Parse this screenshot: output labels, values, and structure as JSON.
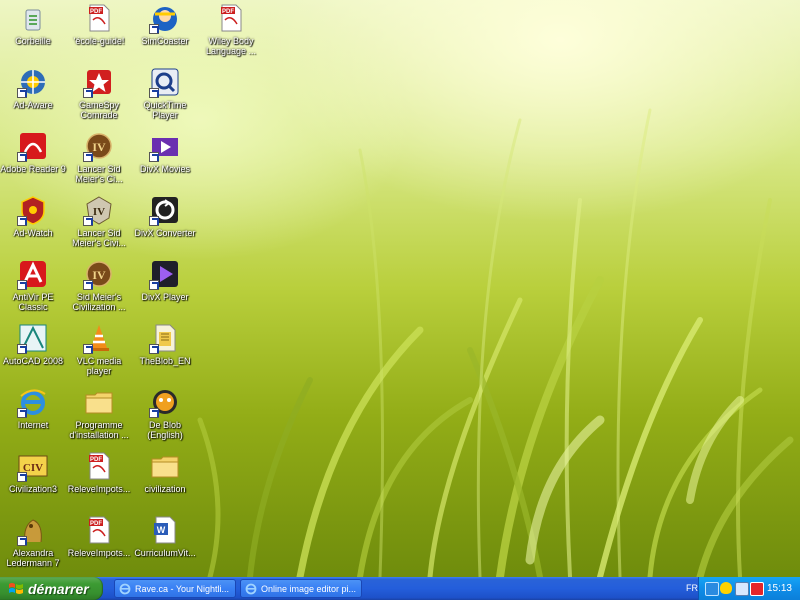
{
  "desktop": {
    "icons": [
      {
        "label": "Corbeille",
        "icon": "recycle-bin-icon",
        "shortcut": false
      },
      {
        "label": "Ad-Aware",
        "icon": "ad-aware-icon",
        "shortcut": true
      },
      {
        "label": "Adobe Reader 9",
        "icon": "adobe-reader-icon",
        "shortcut": true
      },
      {
        "label": "Ad-Watch",
        "icon": "ad-watch-icon",
        "shortcut": true
      },
      {
        "label": "AntiVir PE Classic",
        "icon": "antivir-icon",
        "shortcut": true
      },
      {
        "label": "AutoCAD 2008",
        "icon": "autocad-icon",
        "shortcut": true
      },
      {
        "label": "Internet",
        "icon": "internet-explorer-icon",
        "shortcut": true
      },
      {
        "label": "Civilization3",
        "icon": "civilization3-icon",
        "shortcut": true
      },
      {
        "label": "Alexandra Ledermann 7",
        "icon": "alexandra-ledermann-icon",
        "shortcut": true
      },
      {
        "label": "'école-guide!",
        "icon": "pdf-icon",
        "shortcut": false
      },
      {
        "label": "GameSpy Comrade",
        "icon": "gamespy-icon",
        "shortcut": true
      },
      {
        "label": "Lancer Sid Meier's Ci...",
        "icon": "civ4-icon",
        "shortcut": true
      },
      {
        "label": "Lancer Sid Meier's Civi...",
        "icon": "civ4-warlords-icon",
        "shortcut": true
      },
      {
        "label": "Sid Meier's Civilization ...",
        "icon": "civ4-icon",
        "shortcut": true
      },
      {
        "label": "VLC media player",
        "icon": "vlc-cone-icon",
        "shortcut": true
      },
      {
        "label": "Programme d'installation ...",
        "icon": "folder-icon",
        "shortcut": false
      },
      {
        "label": "ReleveImpots...",
        "icon": "pdf-icon",
        "shortcut": false
      },
      {
        "label": "ReleveImpots...",
        "icon": "pdf-icon",
        "shortcut": false
      },
      {
        "label": "SimCoaster",
        "icon": "simcoaster-icon",
        "shortcut": true
      },
      {
        "label": "QuickTime Player",
        "icon": "quicktime-icon",
        "shortcut": true
      },
      {
        "label": "DivX Movies",
        "icon": "divx-movies-icon",
        "shortcut": true
      },
      {
        "label": "DivX Converter",
        "icon": "divx-converter-icon",
        "shortcut": true
      },
      {
        "label": "DivX Player",
        "icon": "divx-player-icon",
        "shortcut": true
      },
      {
        "label": "TheBlob_EN",
        "icon": "blob-icon",
        "shortcut": true
      },
      {
        "label": "De Blob (English)",
        "icon": "de-blob-icon",
        "shortcut": true
      },
      {
        "label": "civilization",
        "icon": "folder-icon",
        "shortcut": false
      },
      {
        "label": "CurriculumVit...",
        "icon": "word-document-icon",
        "shortcut": false
      },
      {
        "label": "Wiley Body Language ...",
        "icon": "pdf-icon",
        "shortcut": false
      }
    ]
  },
  "taskbar": {
    "start_label": "démarrer",
    "tasks": [
      {
        "label": "Rave.ca - Your Nightli..."
      },
      {
        "label": "Online image editor pi..."
      }
    ],
    "tray": {
      "language": "FR",
      "clock": "15:13"
    }
  }
}
